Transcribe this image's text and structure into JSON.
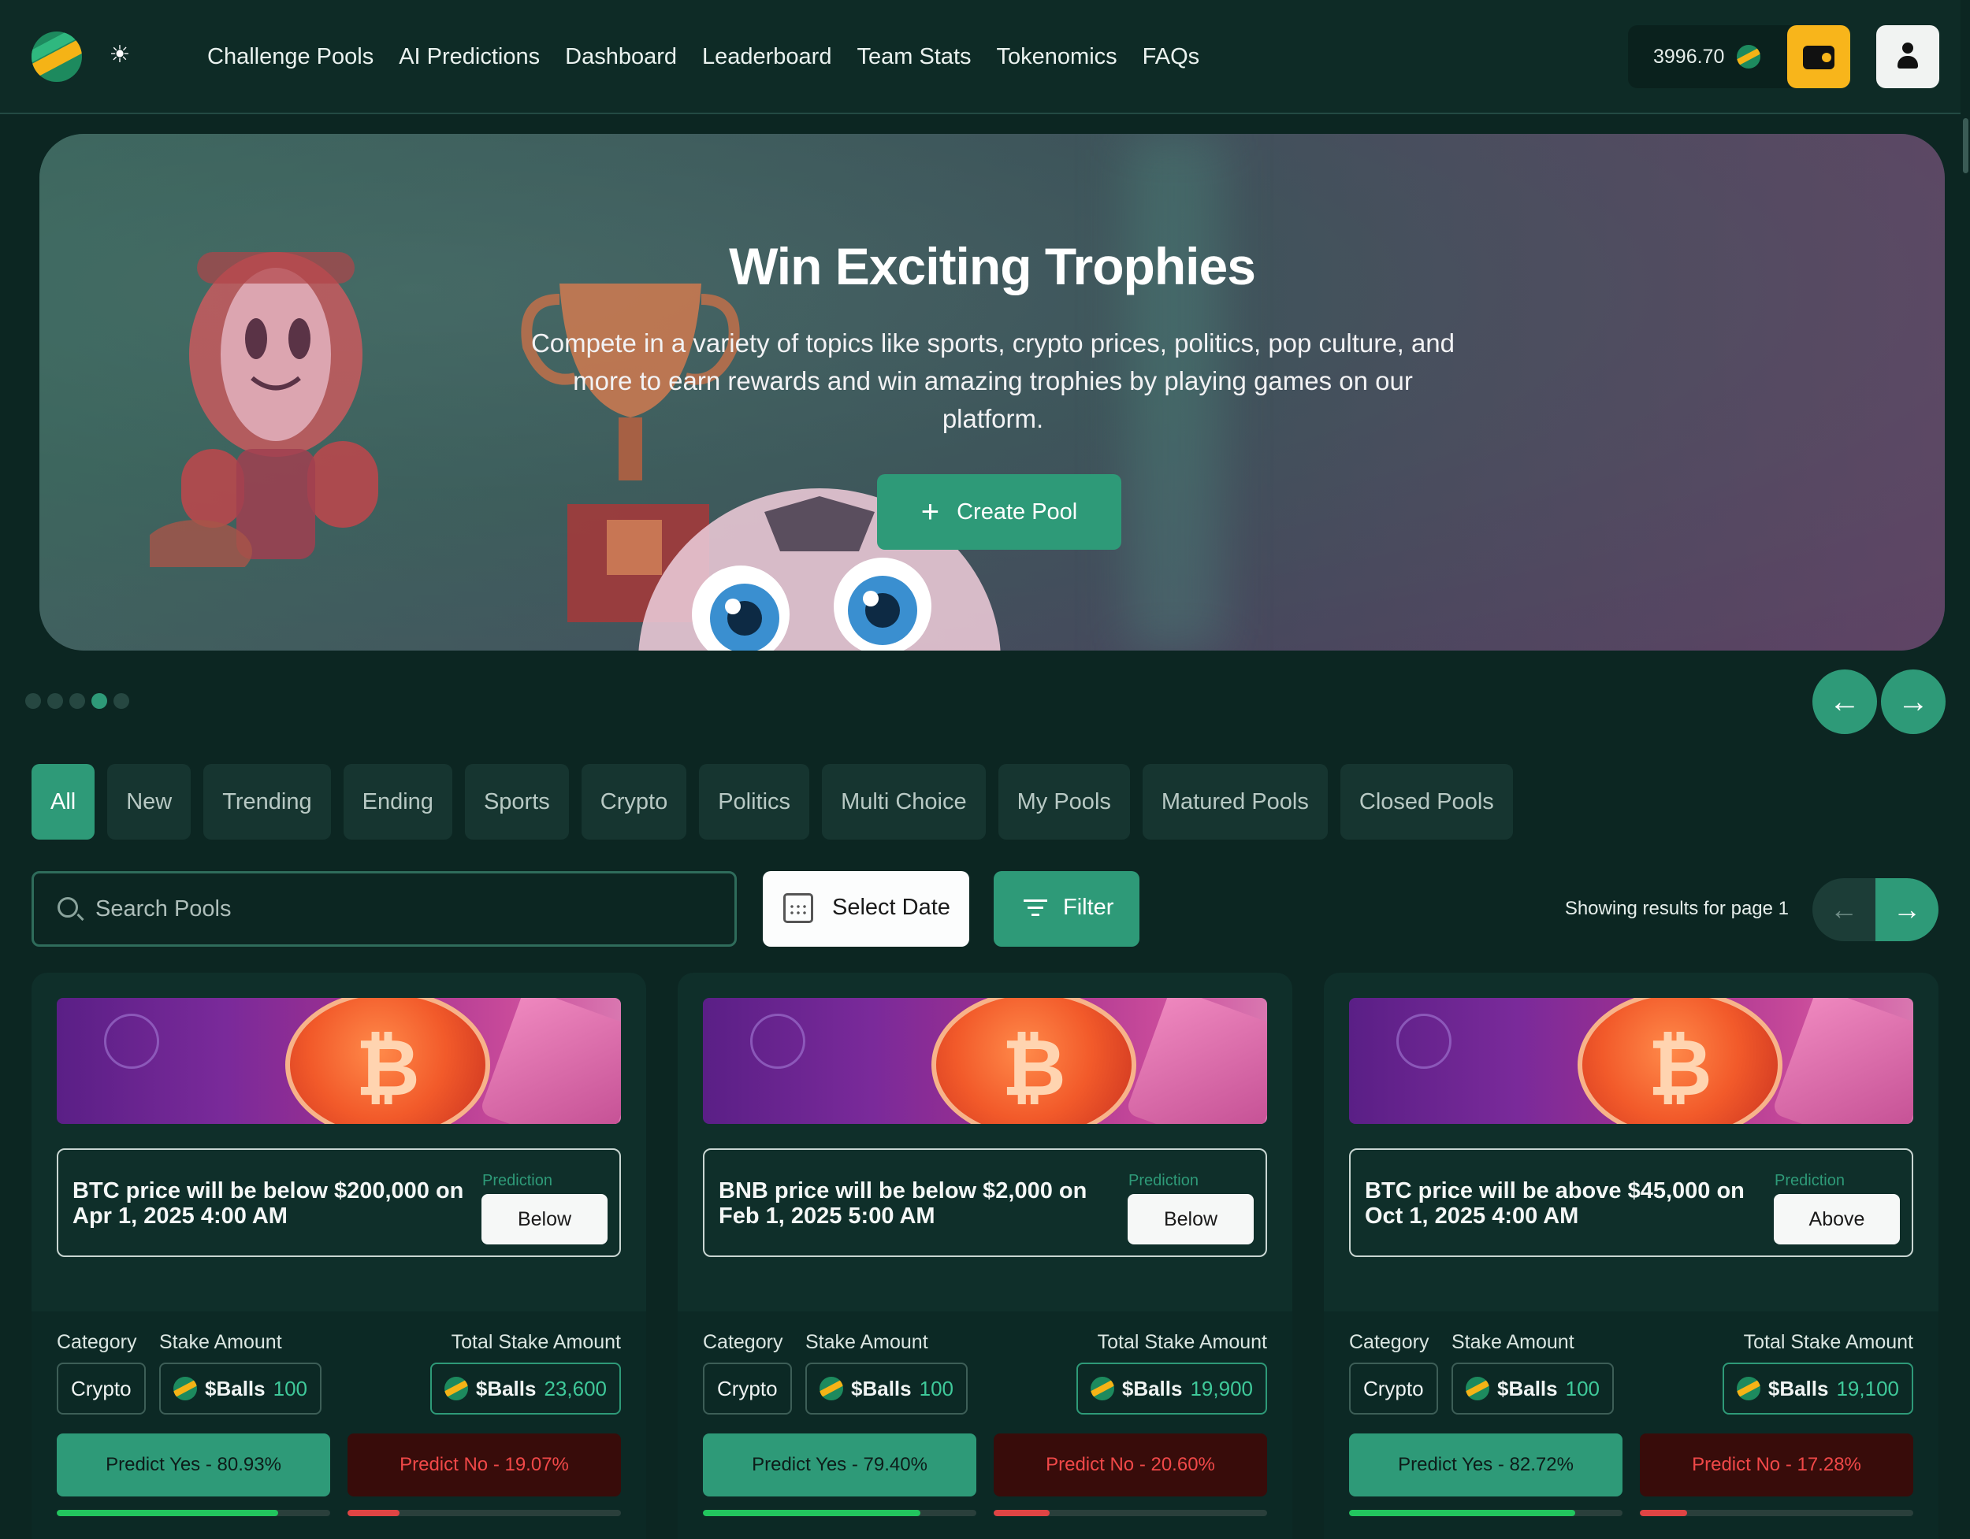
{
  "nav": {
    "links": [
      "Challenge Pools",
      "AI Predictions",
      "Dashboard",
      "Leaderboard",
      "Team Stats",
      "Tokenomics",
      "FAQs"
    ],
    "balance": "3996.70"
  },
  "hero": {
    "title": "Win Exciting Trophies",
    "subtitle": "Compete in a variety of topics like sports, crypto prices, politics, pop culture, and more to earn rewards and win amazing trophies by playing games on our platform.",
    "cta": "Create Pool",
    "slides_total": 5,
    "active_slide": 4
  },
  "tabs": [
    "All",
    "New",
    "Trending",
    "Ending",
    "Sports",
    "Crypto",
    "Politics",
    "Multi Choice",
    "My Pools",
    "Matured Pools",
    "Closed Pools"
  ],
  "active_tab": "All",
  "toolbar": {
    "search_placeholder": "Search Pools",
    "date_label": "Select Date",
    "filter_label": "Filter",
    "showing": "Showing results for page 1"
  },
  "labels": {
    "prediction": "Prediction",
    "category": "Category",
    "stake_amount": "Stake Amount",
    "total_stake_amount": "Total Stake Amount",
    "token": "$Balls"
  },
  "pools": [
    {
      "question": "BTC price will be below $200,000 on Apr 1, 2025 4:00 AM",
      "prediction": "Below",
      "category": "Crypto",
      "stake": "100",
      "total_stake": "23,600",
      "yes_label": "Predict Yes - 80.93%",
      "no_label": "Predict No - 19.07%",
      "yes_pct": 80.93,
      "no_pct": 19.07
    },
    {
      "question": "BNB price will be below $2,000 on Feb 1, 2025 5:00 AM",
      "prediction": "Below",
      "category": "Crypto",
      "stake": "100",
      "total_stake": "19,900",
      "yes_label": "Predict Yes - 79.40%",
      "no_label": "Predict No - 20.60%",
      "yes_pct": 79.4,
      "no_pct": 20.6
    },
    {
      "question": "BTC price will be above $45,000 on Oct 1, 2025 4:00 AM",
      "prediction": "Above",
      "category": "Crypto",
      "stake": "100",
      "total_stake": "19,100",
      "yes_label": "Predict Yes - 82.72%",
      "no_label": "Predict No - 17.28%",
      "yes_pct": 82.72,
      "no_pct": 17.28
    }
  ],
  "colors": {
    "accent": "#2e9a78",
    "background": "#0c2622",
    "wallet": "#f8b51b",
    "no_red": "#f04848"
  },
  "icons": [
    "logo-coin-icon",
    "sun-icon",
    "coin-icon",
    "wallet-icon",
    "user-icon",
    "plus-icon",
    "arrow-left-icon",
    "arrow-right-icon",
    "search-icon",
    "calendar-icon",
    "filter-icon"
  ]
}
